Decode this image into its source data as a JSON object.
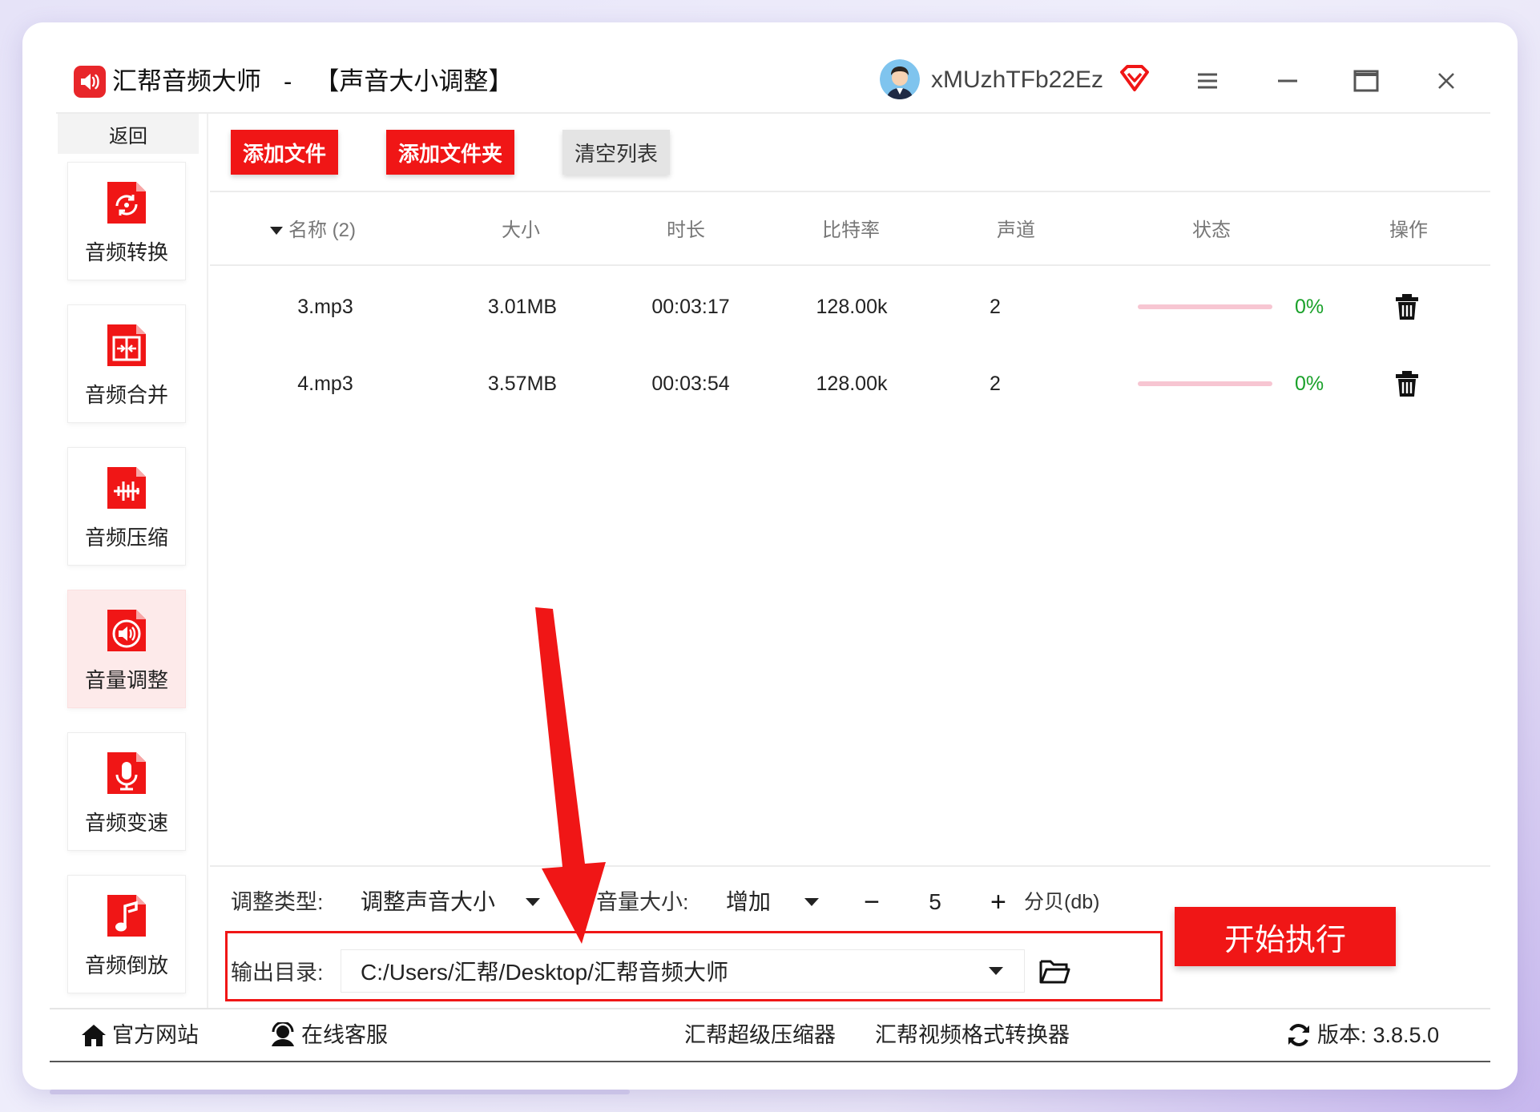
{
  "app": {
    "name": "汇帮音频大师",
    "separator": "-",
    "page": "【声音大小调整】",
    "username": "xMUzhTFb22Ez"
  },
  "sidebar": {
    "back_label": "返回",
    "items": [
      {
        "label": "音频转换",
        "icon": "audio-convert-icon",
        "active": false
      },
      {
        "label": "音频合并",
        "icon": "audio-merge-icon",
        "active": false
      },
      {
        "label": "音频压缩",
        "icon": "audio-compress-icon",
        "active": false
      },
      {
        "label": "音量调整",
        "icon": "volume-adjust-icon",
        "active": true
      },
      {
        "label": "音频变速",
        "icon": "audio-speed-icon",
        "active": false
      },
      {
        "label": "音频倒放",
        "icon": "audio-reverse-icon",
        "active": false
      }
    ]
  },
  "toolbar": {
    "add_file": "添加文件",
    "add_folder": "添加文件夹",
    "clear_list": "清空列表"
  },
  "table": {
    "columns": {
      "name": "名称 (2)",
      "size": "大小",
      "duration": "时长",
      "bitrate": "比特率",
      "channels": "声道",
      "status": "状态",
      "action": "操作"
    },
    "rows": [
      {
        "name": "3.mp3",
        "size": "3.01MB",
        "duration": "00:03:17",
        "bitrate": "128.00k",
        "channels": "2",
        "progress": "0%"
      },
      {
        "name": "4.mp3",
        "size": "3.57MB",
        "duration": "00:03:54",
        "bitrate": "128.00k",
        "channels": "2",
        "progress": "0%"
      }
    ]
  },
  "options": {
    "adjust_type_label": "调整类型:",
    "adjust_type_value": "调整声音大小",
    "volume_label": "音量大小:",
    "volume_mode": "增加",
    "volume_minus": "−",
    "volume_value": "5",
    "volume_plus": "+",
    "volume_unit": "分贝(db)",
    "output_label": "输出目录:",
    "output_path": "C:/Users/汇帮/Desktop/汇帮音频大师",
    "start_button": "开始执行"
  },
  "footer": {
    "official_site": "官方网站",
    "online_service": "在线客服",
    "compressor": "汇帮超级压缩器",
    "video_converter": "汇帮视频格式转换器",
    "version_label": "版本:",
    "version": "3.8.5.0"
  },
  "colors": {
    "accent": "#f01616",
    "progress_track": "#f7c6d2",
    "progress_text": "#1aa12a",
    "active_sidebar": "#fdeaea"
  }
}
